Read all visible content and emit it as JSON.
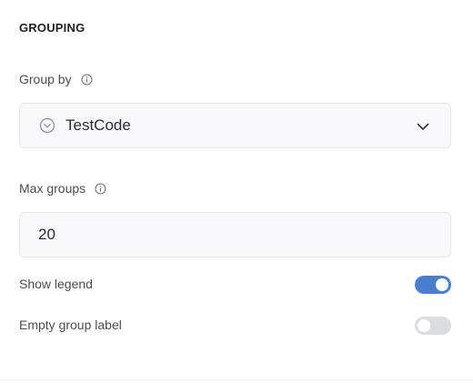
{
  "section": {
    "title": "GROUPING"
  },
  "group_by": {
    "label": "Group by",
    "info_icon": "info-icon",
    "leading_icon": "chevron-circle-down-icon",
    "value": "TestCode",
    "trailing_icon": "chevron-down-icon"
  },
  "max_groups": {
    "label": "Max groups",
    "info_icon": "info-icon",
    "value": "20"
  },
  "show_legend": {
    "label": "Show legend",
    "enabled": true
  },
  "empty_group_label": {
    "label": "Empty group label",
    "enabled": false
  },
  "colors": {
    "toggle_on": "#4a7fd0",
    "toggle_off": "#dcdde0",
    "field_bg": "#f8f8fa",
    "field_border": "#e6e7ea"
  }
}
